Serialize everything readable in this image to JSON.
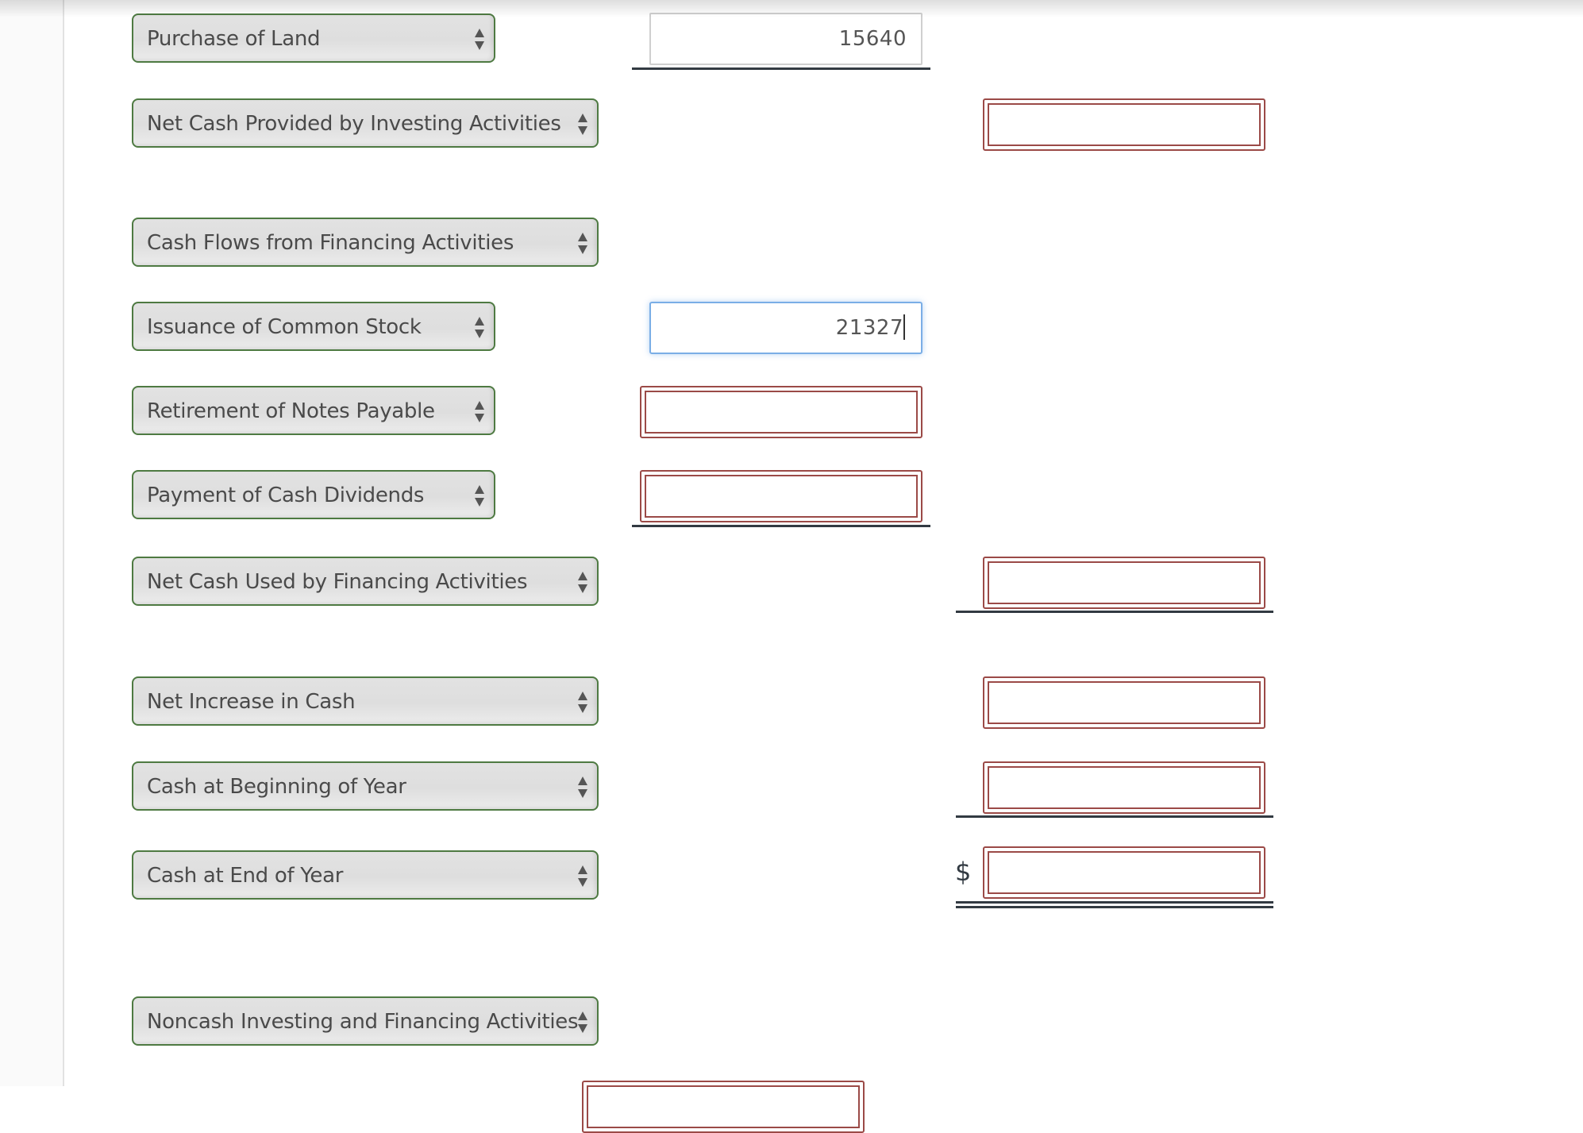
{
  "colors": {
    "select_border": "#4e7a42",
    "error_border": "#9b4a47",
    "focus_border": "#7aaee6",
    "rule": "#323a42"
  },
  "rows": [
    {
      "label": "Purchase of Land",
      "amount_col1": "15640",
      "col1_state": "filled",
      "col2_state": "none"
    },
    {
      "label": "Net Cash Provided by Investing Activities",
      "amount_col1": "",
      "col1_state": "none",
      "col2_state": "error"
    },
    {
      "label": "Cash Flows from Financing Activities",
      "col1_state": "none",
      "col2_state": "none"
    },
    {
      "label": "Issuance of Common Stock",
      "amount_col1": "21327",
      "col1_state": "focused",
      "col2_state": "none"
    },
    {
      "label": "Retirement of Notes Payable",
      "amount_col1": "",
      "col1_state": "error",
      "col2_state": "none"
    },
    {
      "label": "Payment of Cash Dividends",
      "amount_col1": "",
      "col1_state": "error",
      "col2_state": "none"
    },
    {
      "label": "Net Cash Used by Financing Activities",
      "amount_col2": "",
      "col1_state": "none",
      "col2_state": "error"
    },
    {
      "label": "Net Increase in Cash",
      "amount_col2": "",
      "col1_state": "none",
      "col2_state": "error"
    },
    {
      "label": "Cash at Beginning of Year",
      "amount_col2": "",
      "col1_state": "none",
      "col2_state": "error"
    },
    {
      "label": "Cash at End of Year",
      "amount_col2": "",
      "currency_symbol": "$",
      "col1_state": "none",
      "col2_state": "error"
    },
    {
      "label": "Noncash Investing and Financing Activities",
      "col1_state": "none",
      "col2_state": "none"
    }
  ],
  "icons": {
    "select_arrows": "updown-arrows-icon"
  }
}
